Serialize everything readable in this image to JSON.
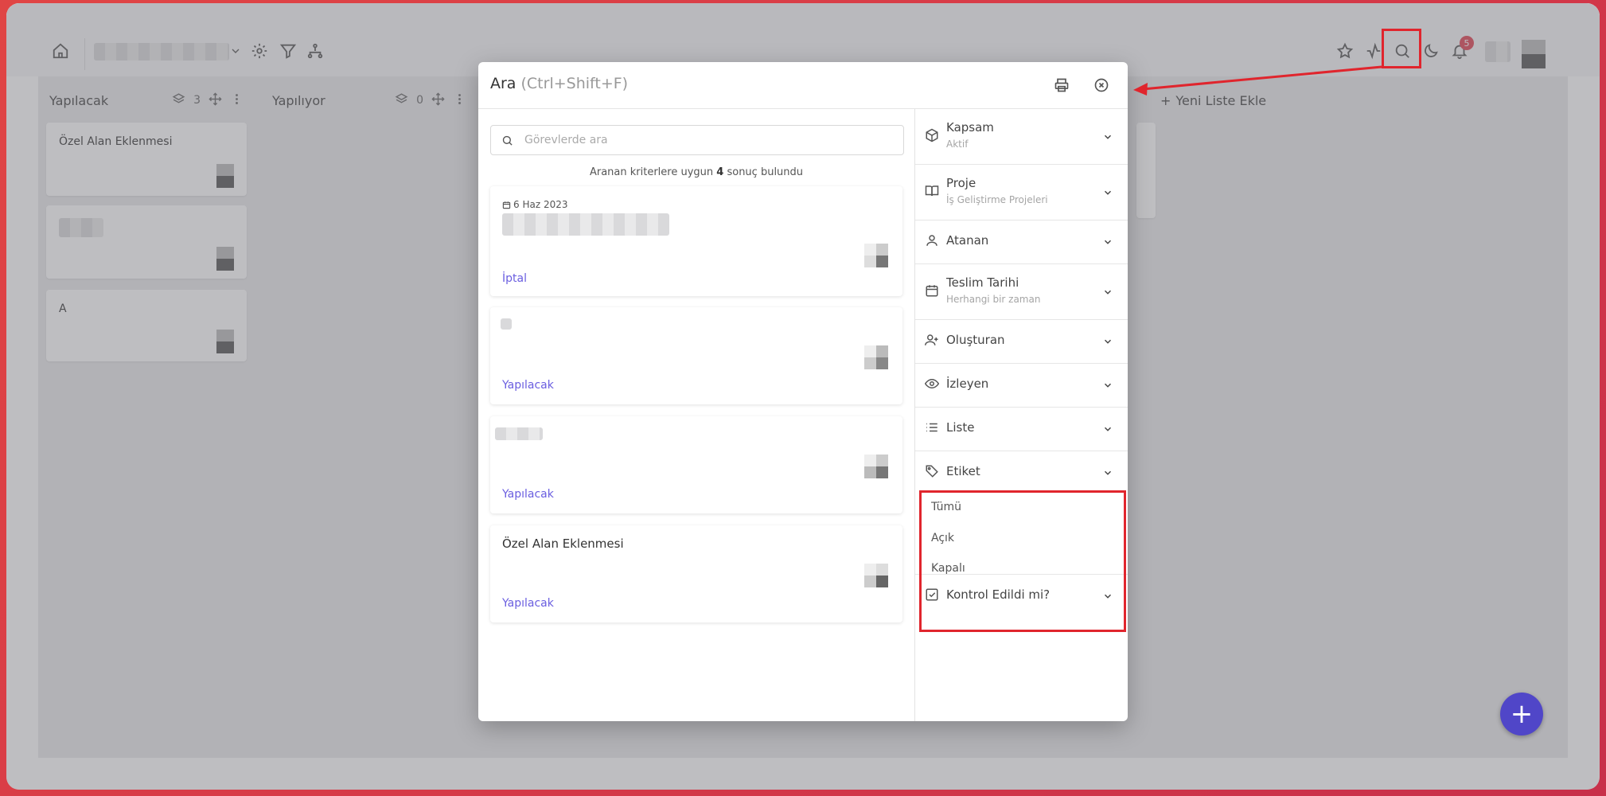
{
  "board": {
    "columns": [
      {
        "name": "Yapılacak",
        "count": "3"
      },
      {
        "name": "Yapılıyor",
        "count": "0"
      }
    ],
    "cards": [
      {
        "title": "Özel Alan Eklenmesi"
      },
      {
        "title": "A"
      }
    ],
    "add_list_label": "Yeni Liste Ekle"
  },
  "header": {
    "notification_count": "5"
  },
  "modal": {
    "title": "Ara",
    "shortcut": "(Ctrl+Shift+F)",
    "search": {
      "placeholder": "Görevlerde ara",
      "value": ""
    },
    "result_prefix": "Aranan kriterlere uygun",
    "result_count": "4",
    "result_suffix": "sonuç bulundu",
    "results": [
      {
        "date": "6 Haz 2023",
        "title": "",
        "status": "İptal"
      },
      {
        "title": "",
        "status": "Yapılacak"
      },
      {
        "title": "",
        "status": "Yapılacak"
      },
      {
        "title": "Özel Alan Eklenmesi",
        "status": "Yapılacak"
      }
    ],
    "filters": [
      {
        "label": "Kapsam",
        "sub": "Aktif",
        "icon": "cube-icon"
      },
      {
        "label": "Proje",
        "sub": "İş Geliştirme Projeleri",
        "icon": "book-icon"
      },
      {
        "label": "Atanan",
        "sub": "",
        "icon": "user-icon"
      },
      {
        "label": "Teslim Tarihi",
        "sub": "Herhangi bir zaman",
        "icon": "calendar-icon"
      },
      {
        "label": "Oluşturan",
        "sub": "",
        "icon": "user-plus-icon"
      },
      {
        "label": "İzleyen",
        "sub": "",
        "icon": "eye-icon"
      },
      {
        "label": "Liste",
        "sub": "",
        "icon": "list-icon"
      },
      {
        "label": "Etiket",
        "sub": "",
        "icon": "tag-icon"
      },
      {
        "label": "Kontrol Edildi mi?",
        "sub": "",
        "icon": "checkbox-icon"
      }
    ],
    "tag_options": [
      "Tümü",
      "Açık",
      "Kapalı"
    ]
  },
  "colors": {
    "accent": "#5046c8",
    "status_text": "#6a5ee0",
    "highlight": "#e0252d",
    "badge": "#e04050"
  }
}
